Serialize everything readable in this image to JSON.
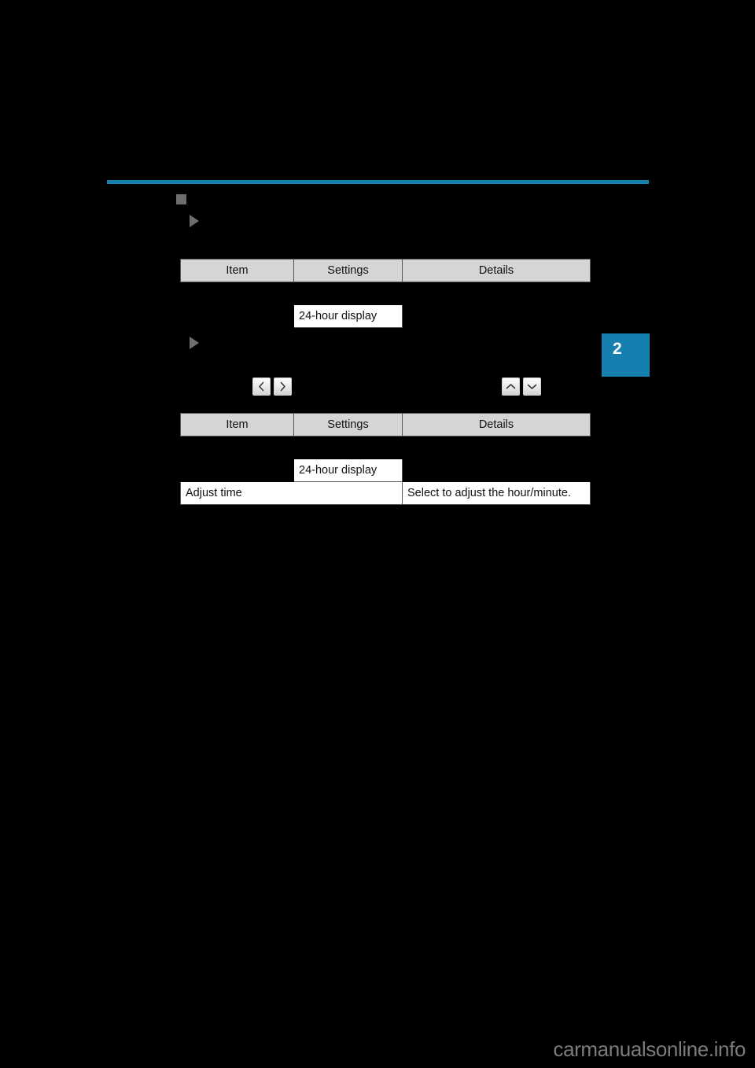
{
  "page": {
    "background_color": "#000000",
    "accent_color": "#1580b0",
    "chapter_tab_number": "2"
  },
  "markers": {
    "square_bullet": "square-bullet-icon",
    "triangle_one": "triangle-marker-icon",
    "triangle_two": "triangle-marker-icon"
  },
  "table_one": {
    "headers": {
      "item": "Item",
      "settings": "Settings",
      "details": "Details"
    },
    "rows": [
      {
        "item": "",
        "settings": "24-hour display",
        "details": ""
      }
    ]
  },
  "nav_buttons": {
    "left": {
      "name": "chevron-left-icon",
      "glyph": "‹"
    },
    "right": {
      "name": "chevron-right-icon",
      "glyph": "›"
    },
    "up": {
      "name": "chevron-up-icon",
      "glyph": "⌃"
    },
    "down": {
      "name": "chevron-down-icon",
      "glyph": "⌄"
    }
  },
  "table_two": {
    "headers": {
      "item": "Item",
      "settings": "Settings",
      "details": "Details"
    },
    "rows": [
      {
        "item": "",
        "settings": "24-hour display",
        "details": ""
      },
      {
        "item": "Adjust time",
        "settings": "",
        "details": "Select to adjust the hour/minute."
      }
    ]
  },
  "footer": {
    "watermark": "carmanualsonline.info"
  }
}
